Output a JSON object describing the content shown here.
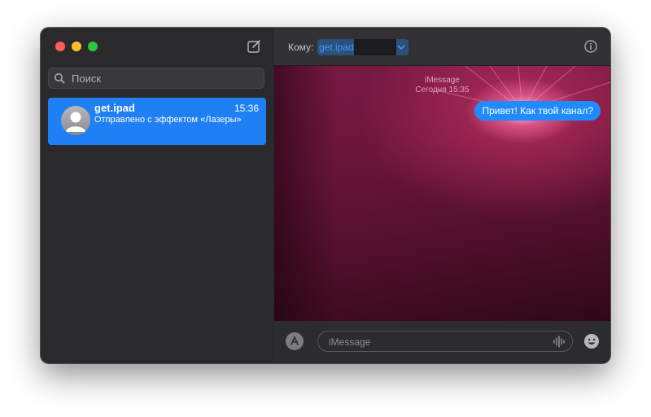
{
  "sidebar": {
    "search": {
      "placeholder": "Поиск"
    },
    "conversations": [
      {
        "name": "get.ipad",
        "time": "15:36",
        "preview": "Отправлено с эффектом «Лазеры»",
        "selected": true
      }
    ]
  },
  "header": {
    "to_label": "Кому:",
    "recipient": "get.ipad"
  },
  "chat": {
    "service_name": "iMessage",
    "timestamp": "Сегодня 15:35",
    "messages": [
      {
        "from": "me",
        "text": "Привет! Как твой канал?"
      }
    ],
    "effect": "Лазеры"
  },
  "composer": {
    "placeholder": "iMessage"
  },
  "colors": {
    "accent": "#1f7ff4",
    "bubble": "#1f8bff",
    "sidebar_bg": "#2a2a2c",
    "chat_effect_pink": "#7a1a43"
  },
  "icons": {
    "compose": "compose-icon",
    "search": "search-icon",
    "info": "info-icon",
    "chevron": "chevron-down-icon",
    "apps": "app-store-icon",
    "audio": "audio-waveform-icon",
    "emoji": "emoji-icon"
  }
}
